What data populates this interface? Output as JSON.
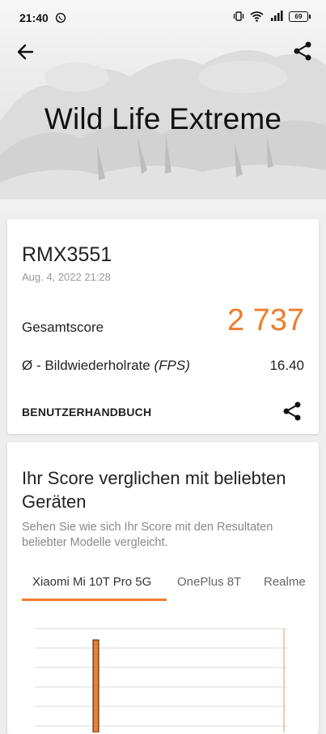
{
  "status_bar": {
    "time": "21:40",
    "battery": "69"
  },
  "header": {
    "title": "Wild Life Extreme"
  },
  "result": {
    "device": "RMX3551",
    "date": "Aug. 4, 2022 21:28",
    "score_label": "Gesamtscore",
    "score_value": "2 737",
    "fps_label_prefix": "Ø - Bildwiederholrate ",
    "fps_label_unit": "(FPS)",
    "fps_value": "16.40",
    "manual_label": "BENUTZERHANDBUCH"
  },
  "comparison": {
    "title": "Ihr Score verglichen mit beliebten Geräten",
    "subtitle": "Sehen Sie wie sich Ihr Score mit den Resultaten beliebter Modelle vergleicht.",
    "tabs": [
      {
        "label": "Xiaomi Mi 10T Pro 5G",
        "active": true
      },
      {
        "label": "OnePlus 8T",
        "active": false
      },
      {
        "label": "Realme",
        "active": false
      }
    ]
  },
  "colors": {
    "accent": "#f07c2b"
  },
  "icons": [
    "whatsapp-icon",
    "vibrate-icon",
    "wifi-icon",
    "signal-icon",
    "battery-icon",
    "back-arrow-icon",
    "share-icon"
  ]
}
